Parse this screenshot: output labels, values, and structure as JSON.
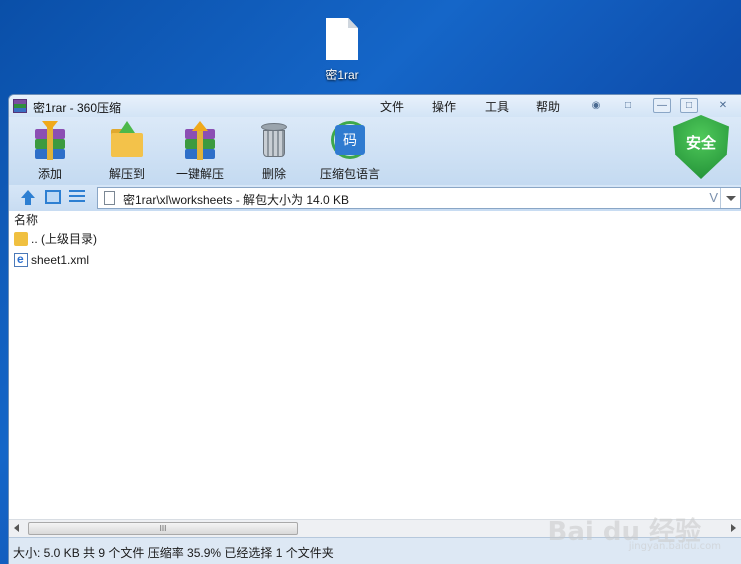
{
  "desktop": {
    "icon_label": "密1rar"
  },
  "window": {
    "title": "密1rar - 360压缩",
    "menu": [
      "文件",
      "操作",
      "工具",
      "帮助"
    ],
    "controls": {
      "minimize": "—",
      "maximize": "□",
      "close": "✕"
    }
  },
  "toolbar": {
    "tools": [
      {
        "label": "添加",
        "icon": "add-archive-icon"
      },
      {
        "label": "解压到",
        "icon": "extract-to-icon"
      },
      {
        "label": "一键解压",
        "icon": "quick-extract-icon"
      },
      {
        "label": "删除",
        "icon": "trash-icon"
      },
      {
        "label": "压缩包语言",
        "icon": "archive-language-icon"
      }
    ],
    "security_badge": "安全"
  },
  "addressbar": {
    "path": "密1rar\\xl\\worksheets - 解包大小为 14.0 KB",
    "dropdown_glyph": "V"
  },
  "filelist": {
    "columns": [
      "名称"
    ],
    "rows": [
      {
        "name": ".. (上级目录)",
        "icon": "folder-icon"
      },
      {
        "name": "sheet1.xml",
        "icon": "xml-file-icon"
      }
    ]
  },
  "scrollbar": {
    "thumb_grip": "III"
  },
  "status": {
    "text": "大小: 5.0 KB 共 9 个文件 压缩率 35.9% 已经选择 1 个文件夹"
  },
  "watermark": {
    "main": "Bai du 经验",
    "sub": "jingyan.baidu.com"
  },
  "colors": {
    "desktop": "#1566c8",
    "accent": "#2d7fd2",
    "security": "#1d8a33"
  }
}
